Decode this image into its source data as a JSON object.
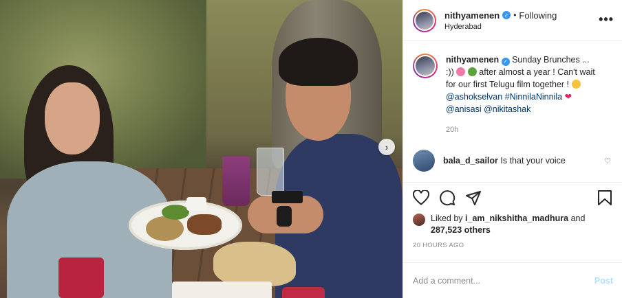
{
  "header": {
    "username": "nithyamenen",
    "separator": "•",
    "follow_status": "Following",
    "location": "Hyderabad",
    "more_label": "•••"
  },
  "caption": {
    "username": "nithyamenen",
    "line1": "Sunday Brunches ... :))",
    "line2": "after almost a year !",
    "line3": "Can't wait for our first Telugu film together !",
    "mention1": "@ashokselvan",
    "hashtag": "#NinnilaNinnila",
    "mention2": "@anisasi",
    "mention3": "@nikitashak",
    "time": "20h"
  },
  "comment": {
    "username": "bala_d_sailor",
    "text": "Is that your voice"
  },
  "likes": {
    "prefix": "Liked by",
    "user": "i_am_nikshitha_madhura",
    "and": "and",
    "count": "287,523 others"
  },
  "timestamp": "20 HOURS AGO",
  "add_comment": {
    "placeholder": "Add a comment...",
    "post_label": "Post"
  },
  "icons": {
    "next": "chevron-right-icon",
    "like": "heart-icon",
    "comment": "comment-bubble-icon",
    "share": "paper-plane-icon",
    "save": "bookmark-icon"
  },
  "colors": {
    "verified": "#3897f0",
    "link": "#00376b",
    "post_disabled": "#b2dffc",
    "muted": "#8e8e8e"
  }
}
